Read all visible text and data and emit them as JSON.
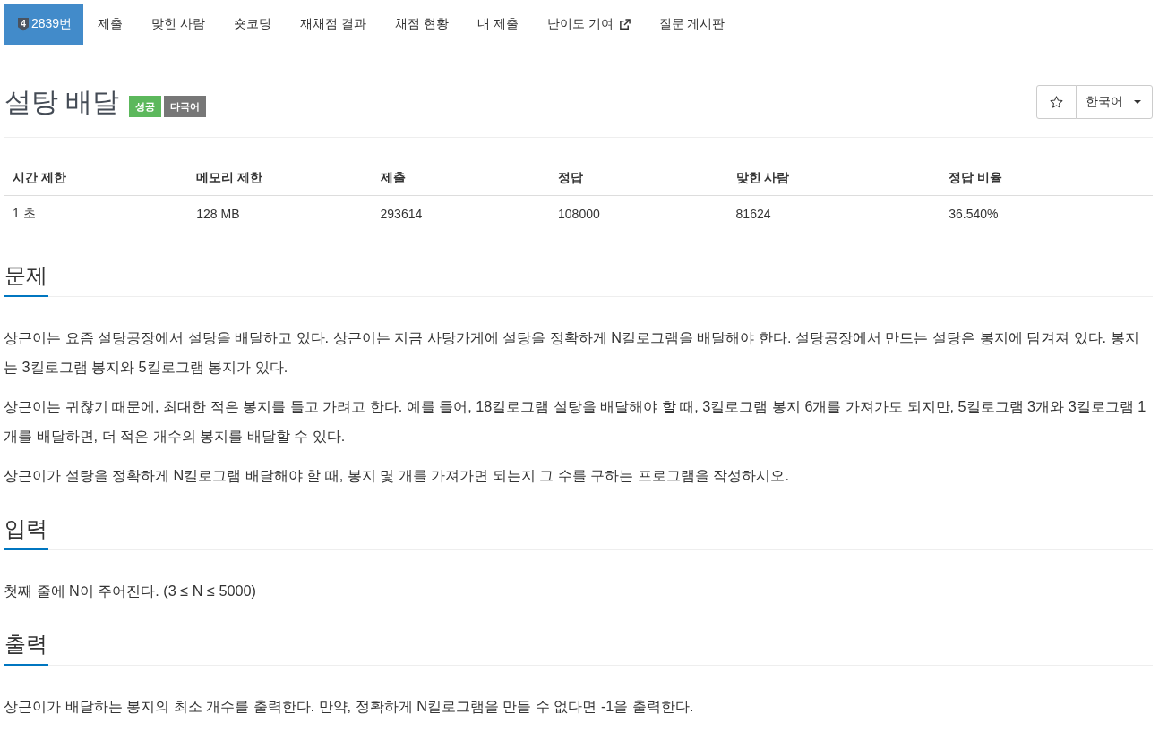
{
  "nav": {
    "tier": "4",
    "tabs": [
      {
        "label": "2839번",
        "kind": "problem",
        "selected": true
      },
      {
        "label": "제출",
        "kind": "plain",
        "selected": false
      },
      {
        "label": "맞힌 사람",
        "kind": "plain",
        "selected": false
      },
      {
        "label": "숏코딩",
        "kind": "plain",
        "selected": false
      },
      {
        "label": "재채점 결과",
        "kind": "plain",
        "selected": false
      },
      {
        "label": "채점 현황",
        "kind": "plain",
        "selected": false
      },
      {
        "label": "내 제출",
        "kind": "plain",
        "selected": false
      },
      {
        "label": "난이도 기여",
        "kind": "external",
        "selected": false
      },
      {
        "label": "질문 게시판",
        "kind": "plain",
        "selected": false
      }
    ]
  },
  "title": "설탕 배달",
  "badges": [
    {
      "label": "성공",
      "color": "#5cb85c"
    },
    {
      "label": "다국어",
      "color": "#777777"
    }
  ],
  "language": "한국어",
  "info_table": {
    "columns": [
      "시간 제한",
      "메모리 제한",
      "제출",
      "정답",
      "맞힌 사람",
      "정답 비율"
    ],
    "rows": [
      [
        "1 초",
        "128 MB",
        "293614",
        "108000",
        "81624",
        "36.540%"
      ]
    ]
  },
  "sections": [
    {
      "heading": "문제",
      "paragraphs": [
        "상근이는 요즘 설탕공장에서 설탕을 배달하고 있다. 상근이는 지금 사탕가게에 설탕을 정확하게 N킬로그램을 배달해야 한다. 설탕공장에서 만드는 설탕은 봉지에 담겨져 있다. 봉지는 3킬로그램 봉지와 5킬로그램 봉지가 있다.",
        "상근이는 귀찮기 때문에, 최대한 적은 봉지를 들고 가려고 한다. 예를 들어, 18킬로그램 설탕을 배달해야 할 때, 3킬로그램 봉지 6개를 가져가도 되지만, 5킬로그램 3개와 3킬로그램 1개를 배달하면, 더 적은 개수의 봉지를 배달할 수 있다.",
        "상근이가 설탕을 정확하게 N킬로그램 배달해야 할 때, 봉지 몇 개를 가져가면 되는지 그 수를 구하는 프로그램을 작성하시오."
      ]
    },
    {
      "heading": "입력",
      "paragraphs": [
        "첫째 줄에 N이 주어진다. (3 ≤ N ≤ 5000)"
      ]
    },
    {
      "heading": "출력",
      "paragraphs": [
        "상근이가 배달하는 봉지의 최소 개수를 출력한다. 만약, 정확하게 N킬로그램을 만들 수 없다면 -1을 출력한다."
      ]
    }
  ]
}
